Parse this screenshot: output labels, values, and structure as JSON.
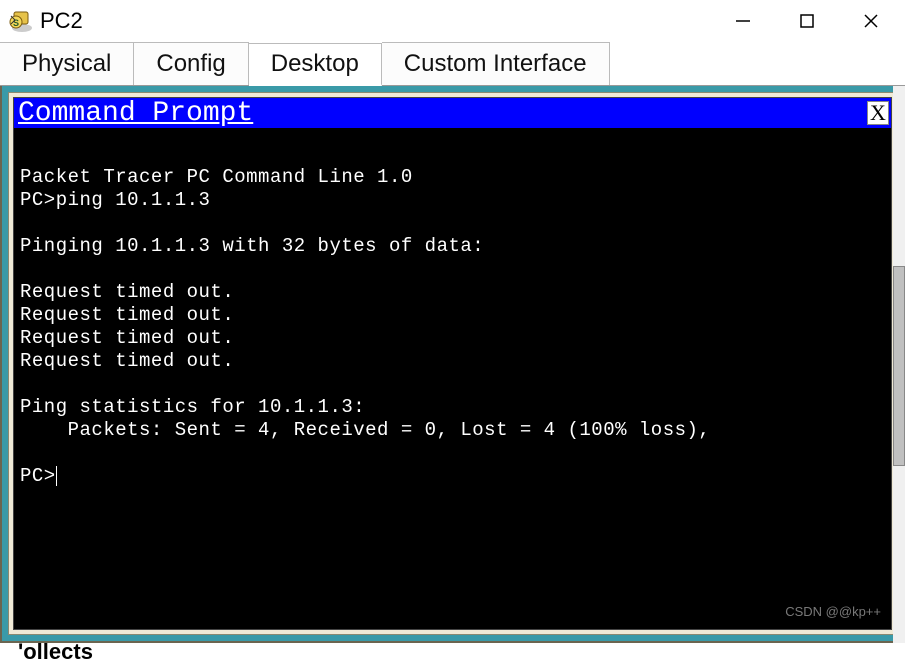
{
  "window": {
    "title": "PC2",
    "controls": {
      "min": "—",
      "max": "▢",
      "close": "✕"
    }
  },
  "tabs": {
    "items": [
      {
        "label": "Physical",
        "active": false
      },
      {
        "label": "Config",
        "active": false
      },
      {
        "label": "Desktop",
        "active": true
      },
      {
        "label": "Custom Interface",
        "active": false
      }
    ]
  },
  "cmd": {
    "title": "Command Prompt",
    "close_label": "X",
    "lines": [
      "Packet Tracer PC Command Line 1.0",
      "PC>ping 10.1.1.3",
      "",
      "Pinging 10.1.1.3 with 32 bytes of data:",
      "",
      "Request timed out.",
      "Request timed out.",
      "Request timed out.",
      "Request timed out.",
      "",
      "Ping statistics for 10.1.1.3:",
      "    Packets: Sent = 4, Received = 0, Lost = 4 (100% loss),",
      "",
      "PC>"
    ]
  },
  "watermark": "CSDN @@kp++",
  "bottom_fragment": "'ollects"
}
